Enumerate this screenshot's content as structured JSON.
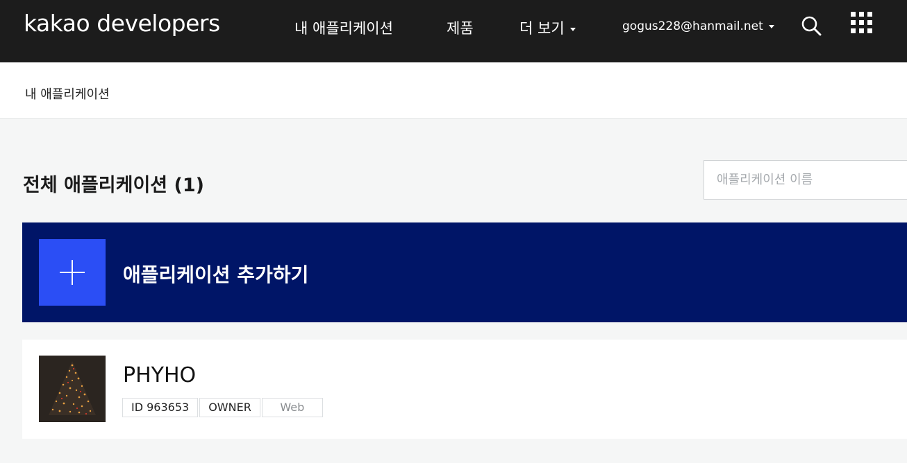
{
  "header": {
    "logo_brand": "kakao",
    "logo_suffix": " developers",
    "nav": [
      {
        "label": "내 애플리케이션"
      },
      {
        "label": "제품"
      },
      {
        "label": "더 보기"
      }
    ],
    "account": "gogus228@hanmail.net",
    "icons": [
      "search-icon",
      "apps-grid-icon"
    ]
  },
  "breadcrumb": "내 애플리케이션",
  "main": {
    "title": "전체 애플리케이션 (1)",
    "search_placeholder": "애플리케이션 이름",
    "add_label": "애플리케이션 추가하기"
  },
  "apps": [
    {
      "name": "PHYHO",
      "tags": [
        "ID 963653",
        "OWNER",
        "Web"
      ]
    }
  ],
  "colors": {
    "topbar": "#1c1c1c",
    "add_panel": "#001567",
    "add_square": "#2b4ef5",
    "page_bg": "#f5f6f6"
  }
}
